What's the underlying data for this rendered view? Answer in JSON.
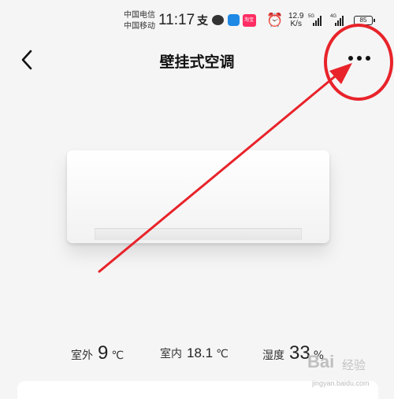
{
  "status_bar": {
    "carrier_1": "中国电信",
    "carrier_2": "中国移动",
    "time": "11:17",
    "alipay_glyph": "支",
    "taobao_glyph": "淘宝",
    "net_speed_value": "12.9",
    "net_speed_unit": "K/s",
    "signal_1_tag": "5G",
    "signal_2_tag": "4G",
    "battery": "85"
  },
  "header": {
    "title": "壁挂式空调"
  },
  "readings": {
    "outdoor_label": "室外",
    "outdoor_value": "9",
    "outdoor_unit": "℃",
    "indoor_label": "室内",
    "indoor_value": "18.1",
    "indoor_unit": "℃",
    "humidity_label": "湿度",
    "humidity_value": "33",
    "humidity_unit": "%"
  },
  "watermark": {
    "logo": "Bai",
    "text": "经验",
    "url": "jingyan.baidu.com"
  },
  "colors": {
    "annotation": "#e8232a",
    "background": "#f5f5f5"
  },
  "icons": [
    "back-arrow-icon",
    "more-dots-icon",
    "alipay-icon",
    "wechat-icon",
    "qqmail-icon",
    "taobao-icon",
    "alarm-icon",
    "battery-icon"
  ]
}
